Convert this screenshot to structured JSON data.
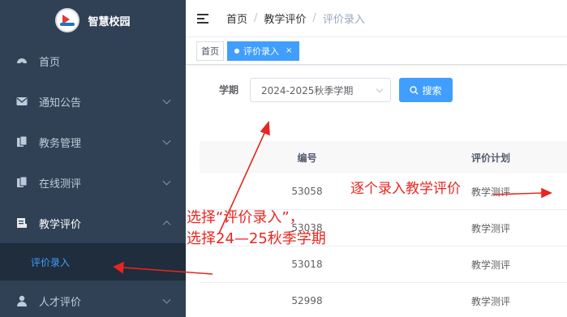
{
  "sidebar": {
    "brand": "智慧校园",
    "items": [
      {
        "label": "首页",
        "icon": "dashboard-icon"
      },
      {
        "label": "通知公告",
        "icon": "mail-icon"
      },
      {
        "label": "教务管理",
        "icon": "document-icon"
      },
      {
        "label": "在线测评",
        "icon": "document-icon"
      },
      {
        "label": "教学评价",
        "icon": "form-icon"
      },
      {
        "label": "人才评价",
        "icon": "user-icon"
      }
    ],
    "sub_item": "评价录入"
  },
  "header": {
    "breadcrumb": [
      "首页",
      "教学评价",
      "评价录入"
    ]
  },
  "tags": {
    "home": "首页",
    "active": "评价录入",
    "close": "×"
  },
  "filter": {
    "label": "学期",
    "semester": "2024-2025秋季学期",
    "search": "搜索"
  },
  "table": {
    "headers": [
      "编号",
      "评价计划"
    ],
    "rows": [
      [
        "53058",
        "教学测评"
      ],
      [
        "53038",
        "教学测评"
      ],
      [
        "53018",
        "教学测评"
      ],
      [
        "52998",
        "教学测评"
      ]
    ]
  },
  "annotations": {
    "entry": "逐个录入教学评价",
    "select_line1": "选择“评价录入”，",
    "select_line2": "选择24—25秋季学期"
  },
  "colors": {
    "sidebar_bg": "#304156",
    "accent": "#409eff",
    "annotation": "#e8261f"
  }
}
